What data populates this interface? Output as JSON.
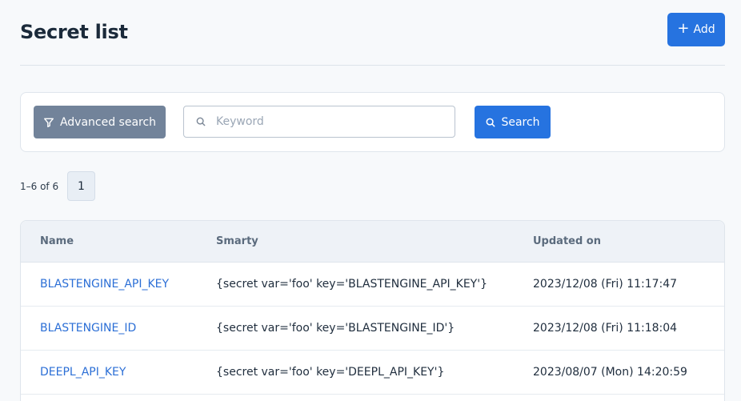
{
  "header": {
    "title": "Secret list",
    "add_label": "Add"
  },
  "search": {
    "advanced_label": "Advanced search",
    "keyword_placeholder": "Keyword",
    "keyword_value": "",
    "search_label": "Search"
  },
  "pagination": {
    "summary": "1–6 of 6",
    "current_page": "1"
  },
  "table": {
    "columns": [
      "Name",
      "Smarty",
      "Updated on"
    ],
    "rows": [
      {
        "name": "BLASTENGINE_API_KEY",
        "smarty": "{secret var='foo' key='BLASTENGINE_API_KEY'}",
        "updated": "2023/12/08 (Fri) 11:17:47"
      },
      {
        "name": "BLASTENGINE_ID",
        "smarty": "{secret var='foo' key='BLASTENGINE_ID'}",
        "updated": "2023/12/08 (Fri) 11:18:04"
      },
      {
        "name": "DEEPL_API_KEY",
        "smarty": "{secret var='foo' key='DEEPL_API_KEY'}",
        "updated": "2023/08/07 (Mon) 14:20:59"
      }
    ]
  },
  "colors": {
    "primary": "#2673e0",
    "secondary": "#72839a",
    "link": "#2c6fd6"
  },
  "icons": {
    "add": "plus-icon",
    "advanced": "filter-icon",
    "keyword": "search-icon",
    "search": "search-icon"
  }
}
